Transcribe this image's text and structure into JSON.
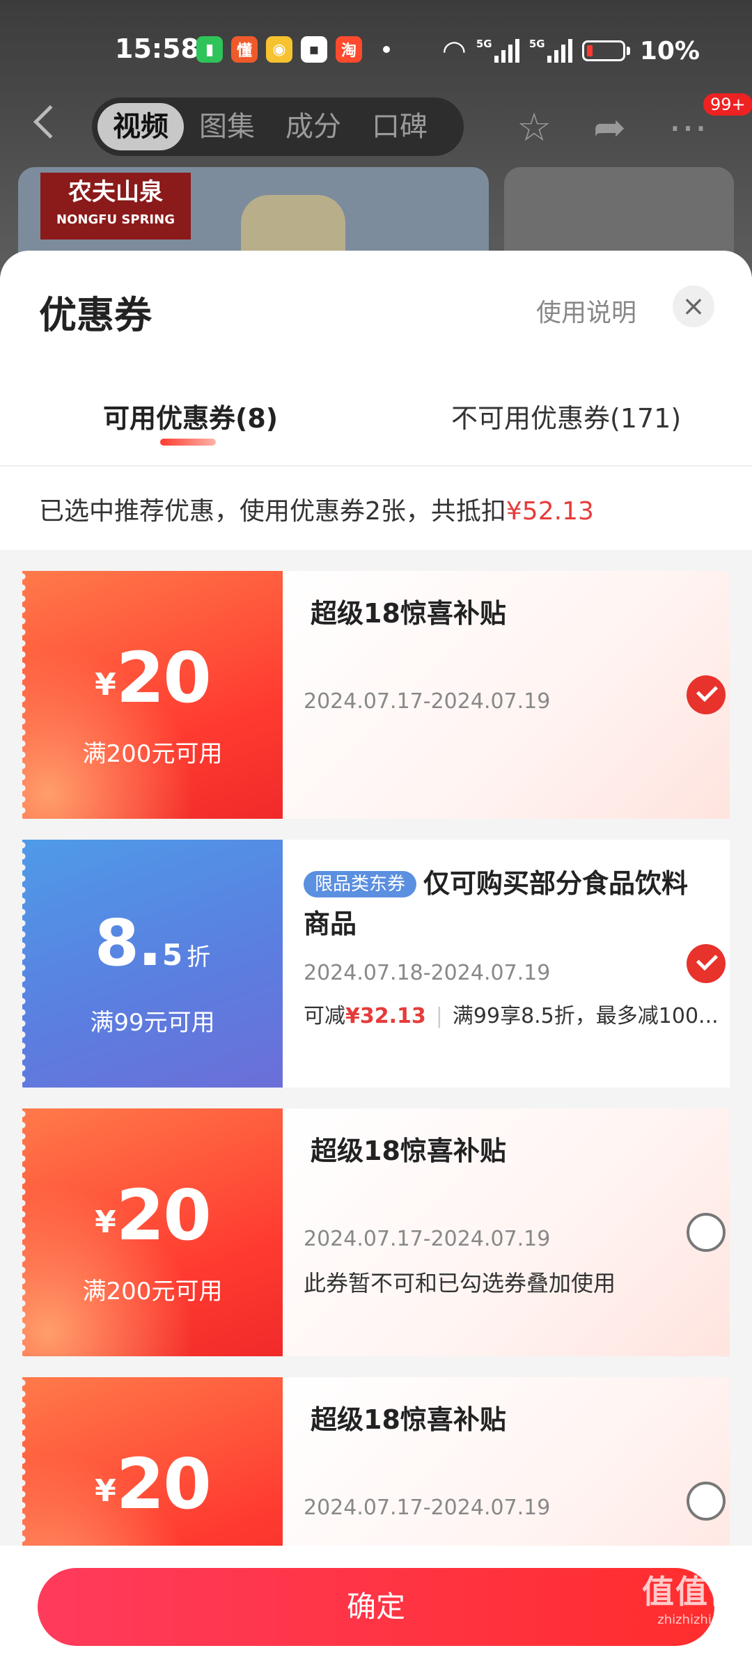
{
  "status_bar": {
    "time": "15:58",
    "battery": "10%",
    "net1": "5G",
    "net2": "5G"
  },
  "header": {
    "tabs": [
      {
        "label": "视频"
      },
      {
        "label": "图集"
      },
      {
        "label": "成分"
      },
      {
        "label": "口碑"
      }
    ],
    "badge": "99+"
  },
  "product": {
    "brand_cn": "农夫山泉",
    "brand_en": "NONGFU SPRING"
  },
  "sheet": {
    "title": "优惠券",
    "usage_link": "使用说明",
    "close_icon": "×",
    "tabs": {
      "available": "可用优惠券(8)",
      "unavailable": "不可用优惠券(171)"
    },
    "summary_text": "已选中推荐优惠，使用优惠券2张，共抵扣",
    "summary_amount": "¥52.13"
  },
  "coupons": [
    {
      "currency": "¥",
      "value": "20",
      "condition": "满200元可用",
      "title": "超级18惊喜补贴",
      "date": "2024.07.17-2024.07.19",
      "selected": true
    },
    {
      "value_main": "8.",
      "value_sub": "5",
      "unit": "折",
      "condition": "满99元可用",
      "tag": "限品类东券",
      "title": "仅可购买部分食品饮料商品",
      "date": "2024.07.18-2024.07.19",
      "deduct_label": "可减",
      "deduct_amount": "¥32.13",
      "rule": "满99享8.5折，最多减100...",
      "selected": true
    },
    {
      "currency": "¥",
      "value": "20",
      "condition": "满200元可用",
      "title": "超级18惊喜补贴",
      "date": "2024.07.17-2024.07.19",
      "note": "此券暂不可和已勾选券叠加使用",
      "selected": false
    },
    {
      "currency": "¥",
      "value": "20",
      "title": "超级18惊喜补贴",
      "date": "2024.07.17-2024.07.19",
      "selected": false
    }
  ],
  "footer": {
    "confirm": "确定"
  },
  "watermark": {
    "main": "值值值",
    "sub": "zhizhizhi.com"
  }
}
